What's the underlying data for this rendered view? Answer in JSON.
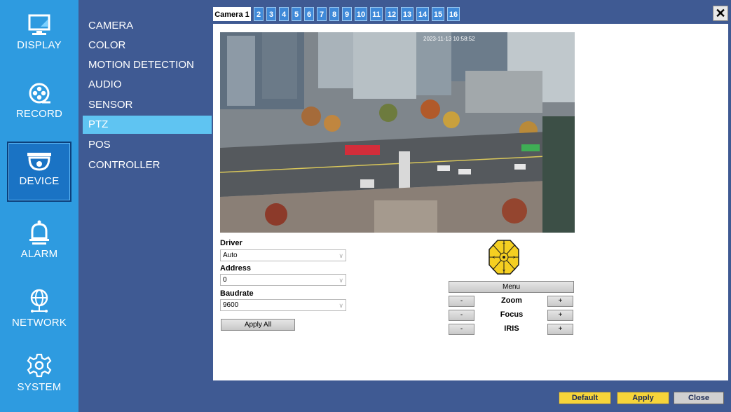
{
  "nav": {
    "items": [
      {
        "label": "DISPLAY"
      },
      {
        "label": "RECORD"
      },
      {
        "label": "DEVICE"
      },
      {
        "label": "ALARM"
      },
      {
        "label": "NETWORK"
      },
      {
        "label": "SYSTEM"
      }
    ],
    "active": "DEVICE"
  },
  "submenu": {
    "items": [
      {
        "label": "CAMERA"
      },
      {
        "label": "COLOR"
      },
      {
        "label": "MOTION DETECTION"
      },
      {
        "label": "AUDIO"
      },
      {
        "label": "SENSOR"
      },
      {
        "label": "PTZ"
      },
      {
        "label": "POS"
      },
      {
        "label": "CONTROLLER"
      }
    ],
    "active": "PTZ"
  },
  "tabs": {
    "items": [
      "Camera 1",
      "2",
      "3",
      "4",
      "5",
      "6",
      "7",
      "8",
      "9",
      "10",
      "11",
      "12",
      "13",
      "14",
      "15",
      "16"
    ],
    "active": "Camera 1",
    "close_label": "✕"
  },
  "video": {
    "timestamp": "2023-11-13 10:58:52"
  },
  "form": {
    "driver": {
      "label": "Driver",
      "value": "Auto"
    },
    "address": {
      "label": "Address",
      "value": "0"
    },
    "baudrate": {
      "label": "Baudrate",
      "value": "9600"
    },
    "apply_all": "Apply All"
  },
  "ptz": {
    "menu_label": "Menu",
    "minus": "-",
    "plus": "+",
    "rows": [
      {
        "label": "Zoom"
      },
      {
        "label": "Focus"
      },
      {
        "label": "IRIS"
      }
    ],
    "pad_color": "#f5cf21"
  },
  "footer": {
    "default_label": "Default",
    "apply_label": "Apply",
    "close_label": "Close"
  },
  "colors": {
    "rail": "#2e9be0",
    "background": "#3f5a93",
    "active_sub": "#5fc4f2",
    "footer_yellow": "#f6d43a"
  }
}
